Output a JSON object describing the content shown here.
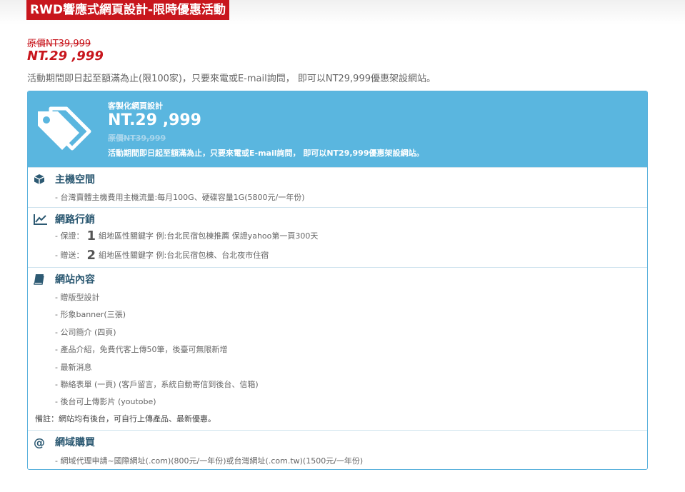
{
  "header": {
    "banner": "RWD響應式網頁設計-限時優惠活動",
    "original_price": "原價NT39,999",
    "sale_price": "NT.29 ,999",
    "description": "活動期間即日起至額滿為止(限100家)，只要來電或E-mail詢問， 即可以NT29,999優惠架設網站。"
  },
  "card": {
    "label": "客製化網頁設計",
    "price": "NT.29 ,999",
    "original_price": "原價NT39,999",
    "description": "活動期間即日起至額滿為止，只要來電或E-mail詢問， 即可以NT29,999優惠架設網站。",
    "icon": "tags-icon",
    "accent_color": "#5ab6df",
    "sale_color": "#c8161d"
  },
  "sections": {
    "hosting": {
      "title": "主機空間",
      "icon": "cube-icon",
      "items": [
        "- 台灣賣體主機費用主機流量:每月100G、硬碟容量1G(5800元/一年份)"
      ]
    },
    "marketing": {
      "title": "網路行銷",
      "icon": "line-chart-icon",
      "items": [
        {
          "prefix": "- 保證：",
          "number": "1",
          "text": "組地區性關鍵字 例:台北民宿包棟推薦 保證yahoo第一頁300天"
        },
        {
          "prefix": "- 贈送：",
          "number": "2",
          "text": "組地區性關鍵字 例:台北民宿包棟、台北夜市住宿"
        }
      ]
    },
    "content": {
      "title": "網站內容",
      "icon": "book-icon",
      "items": [
        "- 贈版型設計",
        "- 形象banner(三張)",
        "- 公司簡介 (四頁)",
        "- 產品介紹，免費代客上傳50筆，後臺可無限新增",
        "- 最新消息",
        "- 聯絡表單 (一頁) (客戶留言，系統自動寄信到後台、信箱)",
        "- 後台可上傳影片 (youtobe)"
      ],
      "note": "備註：網站均有後台，可自行上傳產品、最新優惠。"
    },
    "domain": {
      "title": "網域購買",
      "icon": "at-icon",
      "items": [
        "- 網域代理申請~國際網址(.com)(800元/一年份)或台灣網址(.com.tw)(1500元/一年份)"
      ]
    }
  }
}
